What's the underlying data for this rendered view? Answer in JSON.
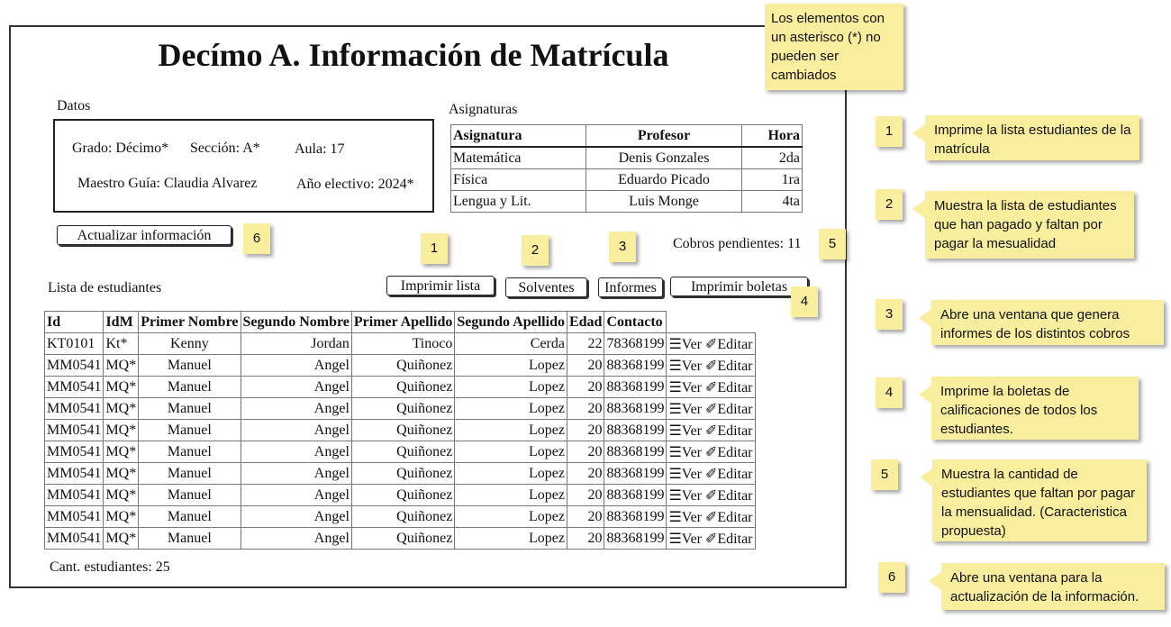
{
  "title": "Decímo A. Información de Matrícula",
  "datos": {
    "heading": "Datos",
    "grado": "Grado: Décimo*",
    "seccion": "Sección: A*",
    "aula": "Aula: 17",
    "maestro": "Maestro Guía: Claudia Alvarez",
    "anio": "Año electivo: 2024*"
  },
  "actualizar_button": "Actualizar información",
  "asignaturas": {
    "heading": "Asignaturas",
    "columns": [
      "Asignatura",
      "Profesor",
      "Hora"
    ],
    "rows": [
      [
        "Matemática",
        "Denis Gonzales",
        "2da"
      ],
      [
        "Física",
        "Eduardo Picado",
        "1ra"
      ],
      [
        "Lengua y Lit.",
        "Luis Monge",
        "4ta"
      ]
    ]
  },
  "cobros": "Cobros pendientes: 11",
  "lista_heading": "Lista de estudiantes",
  "buttons": {
    "imprimir_lista": "Imprimir lista",
    "solventes": "Solventes",
    "informes": "Informes",
    "imprimir_boletas": "Imprimir boletas"
  },
  "students": {
    "columns": [
      "Id",
      "IdM",
      "Primer Nombre",
      "Segundo Nombre",
      "Primer Apellido",
      "Segundo Apellido",
      "Edad",
      "Contacto"
    ],
    "view_label": "☰Ver",
    "edit_label": "✐Editar",
    "rows": [
      [
        "KT0101",
        "Kt*",
        "Kenny",
        "Jordan",
        "Tinoco",
        "Cerda",
        "22",
        "78368199"
      ],
      [
        "MM0541",
        "MQ*",
        "Manuel",
        "Angel",
        "Quiñonez",
        "Lopez",
        "20",
        "88368199"
      ],
      [
        "MM0541",
        "MQ*",
        "Manuel",
        "Angel",
        "Quiñonez",
        "Lopez",
        "20",
        "88368199"
      ],
      [
        "MM0541",
        "MQ*",
        "Manuel",
        "Angel",
        "Quiñonez",
        "Lopez",
        "20",
        "88368199"
      ],
      [
        "MM0541",
        "MQ*",
        "Manuel",
        "Angel",
        "Quiñonez",
        "Lopez",
        "20",
        "88368199"
      ],
      [
        "MM0541",
        "MQ*",
        "Manuel",
        "Angel",
        "Quiñonez",
        "Lopez",
        "20",
        "88368199"
      ],
      [
        "MM0541",
        "MQ*",
        "Manuel",
        "Angel",
        "Quiñonez",
        "Lopez",
        "20",
        "88368199"
      ],
      [
        "MM0541",
        "MQ*",
        "Manuel",
        "Angel",
        "Quiñonez",
        "Lopez",
        "20",
        "88368199"
      ],
      [
        "MM0541",
        "MQ*",
        "Manuel",
        "Angel",
        "Quiñonez",
        "Lopez",
        "20",
        "88368199"
      ],
      [
        "MM0541",
        "MQ*",
        "Manuel",
        "Angel",
        "Quiñonez",
        "Lopez",
        "20",
        "88368199"
      ]
    ]
  },
  "cant_estudiantes": "Cant. estudiantes: 25",
  "notes": {
    "asterisk": "Los elementos con un asterisco (*) no pueden ser cambiados",
    "markers": [
      "1",
      "2",
      "3",
      "4",
      "5",
      "6"
    ],
    "callouts": [
      "Imprime la lista estudiantes de la matrícula",
      "Muestra la lista de estudiantes que han pagado y faltan por pagar la mesualidad",
      "Abre una ventana que genera informes de los distintos cobros",
      "Imprime la boletas de calificaciones de todos los estudiantes.",
      "Muestra la cantidad de estudiantes que faltan por pagar la mensualidad. (Caracteristica propuesta)",
      "Abre una ventana para la actualización de la información."
    ]
  },
  "colors": {
    "note": "#f9ed9e",
    "border": "#222222"
  }
}
